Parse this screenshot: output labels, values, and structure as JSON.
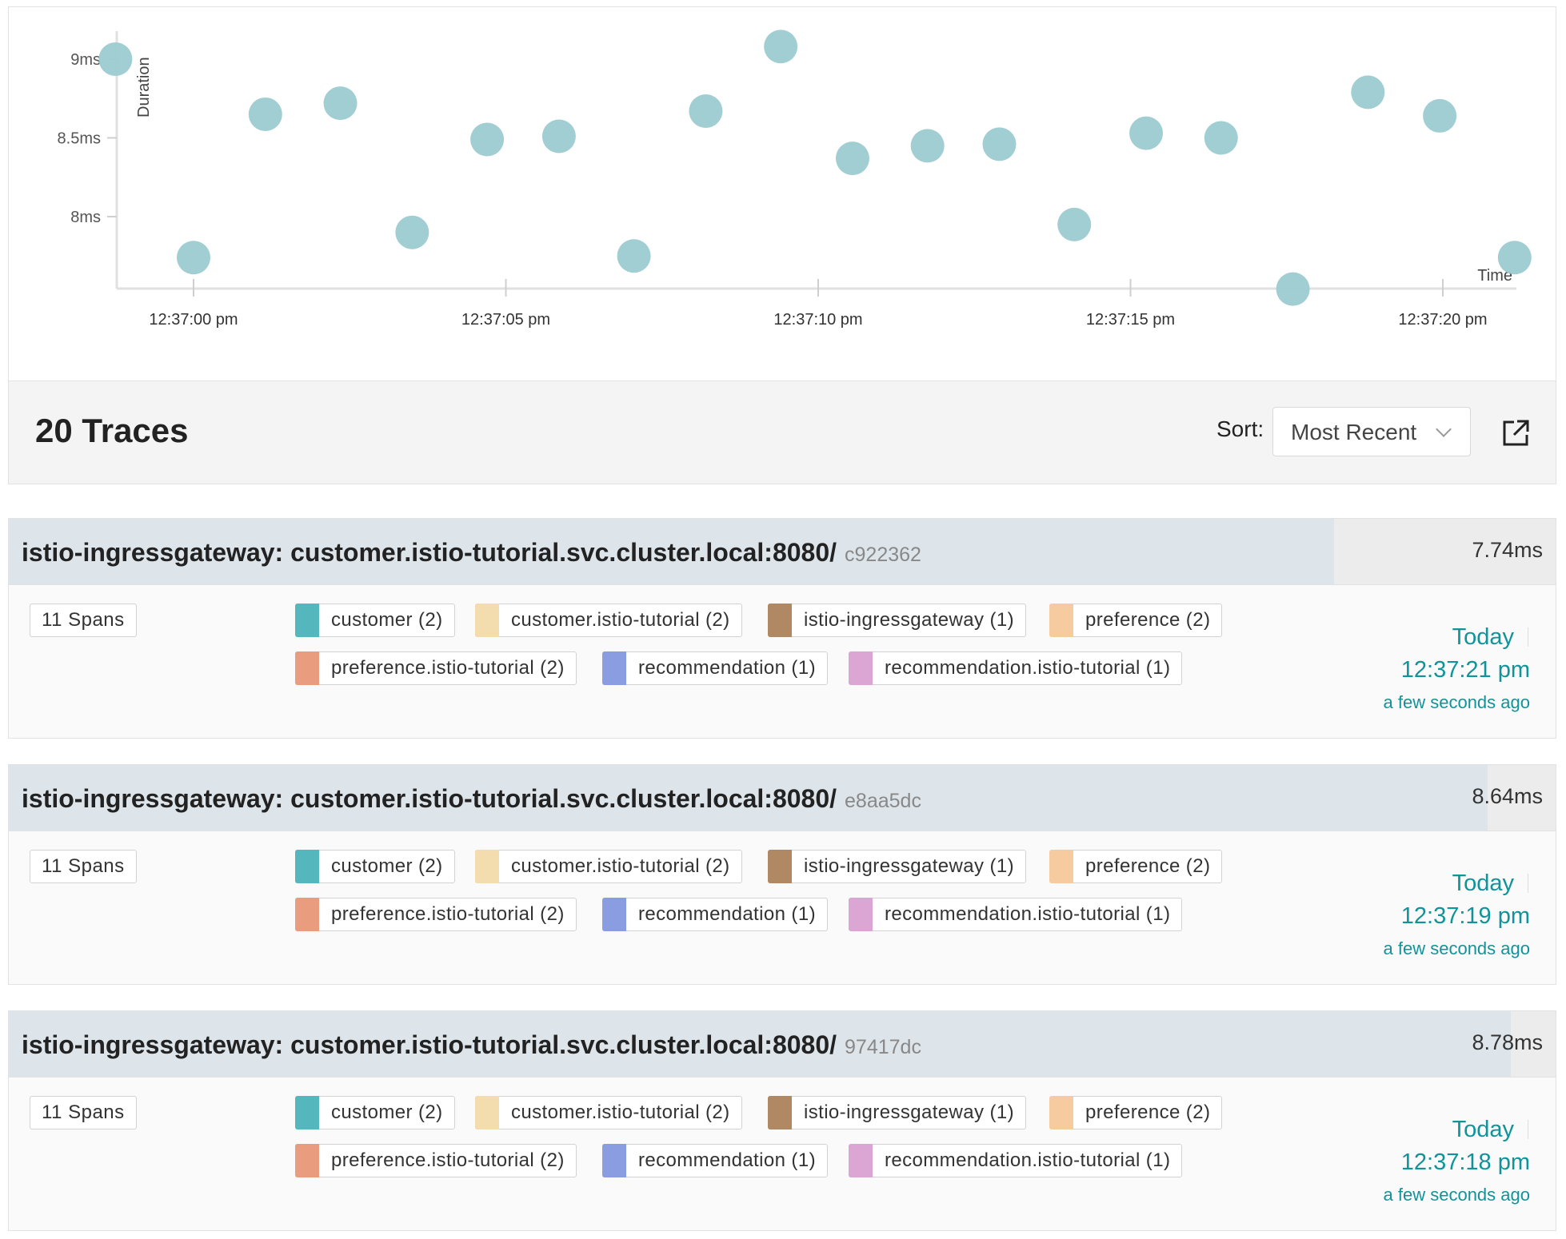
{
  "chart_data": {
    "type": "scatter",
    "xlabel": "Time",
    "ylabel": "Duration",
    "y_ticks": [
      {
        "value": 8.0,
        "label": "8ms"
      },
      {
        "value": 8.5,
        "label": "8.5ms"
      },
      {
        "value": 9.0,
        "label": "9ms"
      }
    ],
    "x_ticks": [
      {
        "value": 0,
        "label": "12:37:00 pm"
      },
      {
        "value": 5,
        "label": "12:37:05 pm"
      },
      {
        "value": 10,
        "label": "12:37:10 pm"
      },
      {
        "value": 15,
        "label": "12:37:15 pm"
      },
      {
        "value": 20,
        "label": "12:37:20 pm"
      }
    ],
    "x_unit": "seconds after 12:37:00 pm",
    "y_unit": "ms",
    "point_color": "#9ccbd0",
    "points": [
      {
        "x": -1.25,
        "y": 9.0
      },
      {
        "x": 0.0,
        "y": 7.74
      },
      {
        "x": 1.15,
        "y": 8.65
      },
      {
        "x": 2.35,
        "y": 8.72
      },
      {
        "x": 3.5,
        "y": 7.9
      },
      {
        "x": 4.7,
        "y": 8.49
      },
      {
        "x": 5.85,
        "y": 8.51
      },
      {
        "x": 7.05,
        "y": 7.75
      },
      {
        "x": 8.2,
        "y": 8.67
      },
      {
        "x": 9.4,
        "y": 9.08
      },
      {
        "x": 10.55,
        "y": 8.37
      },
      {
        "x": 11.75,
        "y": 8.45
      },
      {
        "x": 12.9,
        "y": 8.46
      },
      {
        "x": 14.1,
        "y": 7.95
      },
      {
        "x": 15.25,
        "y": 8.53
      },
      {
        "x": 16.45,
        "y": 8.5
      },
      {
        "x": 17.6,
        "y": 7.54
      },
      {
        "x": 18.8,
        "y": 8.79
      },
      {
        "x": 19.95,
        "y": 8.64
      },
      {
        "x": 21.15,
        "y": 7.74
      }
    ]
  },
  "results": {
    "count_label": "20 Traces",
    "sort_label": "Sort:",
    "sort_value": "Most Recent"
  },
  "trace_template": {
    "spans_label": "11 Spans",
    "tags": [
      {
        "label": "customer (2)",
        "color": "#54b7bd"
      },
      {
        "label": "customer.istio-tutorial (2)",
        "color": "#f3dcae"
      },
      {
        "label": "istio-ingressgateway (1)",
        "color": "#b08864"
      },
      {
        "label": "preference (2)",
        "color": "#f7cba0"
      },
      {
        "label": "preference.istio-tutorial (2)",
        "color": "#ea9c7e"
      },
      {
        "label": "recommendation (1)",
        "color": "#8a9de0"
      },
      {
        "label": "recommendation.istio-tutorial (1)",
        "color": "#dba6d4"
      }
    ]
  },
  "traces": [
    {
      "title": "istio-ingressgateway: customer.istio-tutorial.svc.cluster.local:8080/",
      "trace_id": "c922362",
      "duration": "7.74ms",
      "duration_fraction": 0.857,
      "spans": "11 Spans",
      "day": "Today",
      "time": "12:37:21 pm",
      "ago": "a few seconds ago"
    },
    {
      "title": "istio-ingressgateway: customer.istio-tutorial.svc.cluster.local:8080/",
      "trace_id": "e8aa5dc",
      "duration": "8.64ms",
      "duration_fraction": 0.956,
      "spans": "11 Spans",
      "day": "Today",
      "time": "12:37:19 pm",
      "ago": "a few seconds ago"
    },
    {
      "title": "istio-ingressgateway: customer.istio-tutorial.svc.cluster.local:8080/",
      "trace_id": "97417dc",
      "duration": "8.78ms",
      "duration_fraction": 0.971,
      "spans": "11 Spans",
      "day": "Today",
      "time": "12:37:18 pm",
      "ago": "a few seconds ago"
    }
  ]
}
